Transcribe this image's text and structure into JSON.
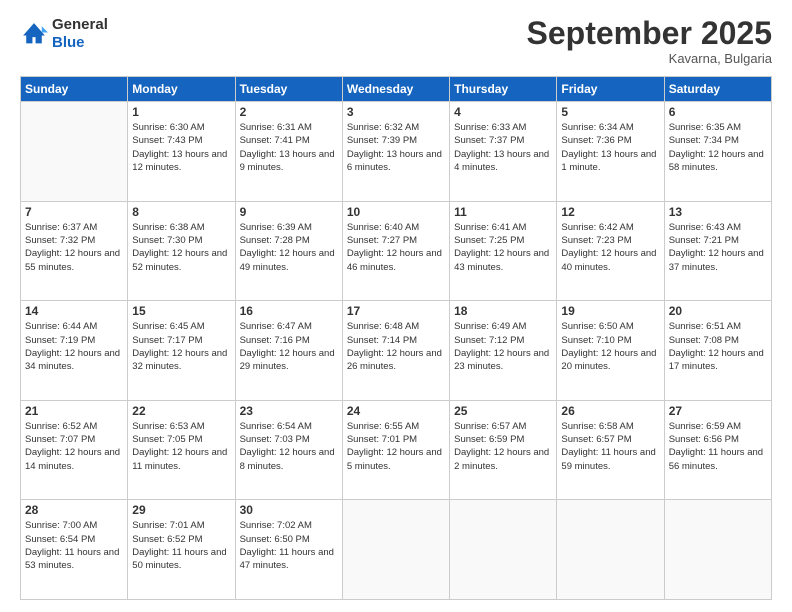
{
  "logo": {
    "line1": "General",
    "line2": "Blue"
  },
  "title": "September 2025",
  "subtitle": "Kavarna, Bulgaria",
  "days_header": [
    "Sunday",
    "Monday",
    "Tuesday",
    "Wednesday",
    "Thursday",
    "Friday",
    "Saturday"
  ],
  "weeks": [
    [
      {
        "day": "",
        "sunrise": "",
        "sunset": "",
        "daylight": ""
      },
      {
        "day": "1",
        "sunrise": "Sunrise: 6:30 AM",
        "sunset": "Sunset: 7:43 PM",
        "daylight": "Daylight: 13 hours and 12 minutes."
      },
      {
        "day": "2",
        "sunrise": "Sunrise: 6:31 AM",
        "sunset": "Sunset: 7:41 PM",
        "daylight": "Daylight: 13 hours and 9 minutes."
      },
      {
        "day": "3",
        "sunrise": "Sunrise: 6:32 AM",
        "sunset": "Sunset: 7:39 PM",
        "daylight": "Daylight: 13 hours and 6 minutes."
      },
      {
        "day": "4",
        "sunrise": "Sunrise: 6:33 AM",
        "sunset": "Sunset: 7:37 PM",
        "daylight": "Daylight: 13 hours and 4 minutes."
      },
      {
        "day": "5",
        "sunrise": "Sunrise: 6:34 AM",
        "sunset": "Sunset: 7:36 PM",
        "daylight": "Daylight: 13 hours and 1 minute."
      },
      {
        "day": "6",
        "sunrise": "Sunrise: 6:35 AM",
        "sunset": "Sunset: 7:34 PM",
        "daylight": "Daylight: 12 hours and 58 minutes."
      }
    ],
    [
      {
        "day": "7",
        "sunrise": "Sunrise: 6:37 AM",
        "sunset": "Sunset: 7:32 PM",
        "daylight": "Daylight: 12 hours and 55 minutes."
      },
      {
        "day": "8",
        "sunrise": "Sunrise: 6:38 AM",
        "sunset": "Sunset: 7:30 PM",
        "daylight": "Daylight: 12 hours and 52 minutes."
      },
      {
        "day": "9",
        "sunrise": "Sunrise: 6:39 AM",
        "sunset": "Sunset: 7:28 PM",
        "daylight": "Daylight: 12 hours and 49 minutes."
      },
      {
        "day": "10",
        "sunrise": "Sunrise: 6:40 AM",
        "sunset": "Sunset: 7:27 PM",
        "daylight": "Daylight: 12 hours and 46 minutes."
      },
      {
        "day": "11",
        "sunrise": "Sunrise: 6:41 AM",
        "sunset": "Sunset: 7:25 PM",
        "daylight": "Daylight: 12 hours and 43 minutes."
      },
      {
        "day": "12",
        "sunrise": "Sunrise: 6:42 AM",
        "sunset": "Sunset: 7:23 PM",
        "daylight": "Daylight: 12 hours and 40 minutes."
      },
      {
        "day": "13",
        "sunrise": "Sunrise: 6:43 AM",
        "sunset": "Sunset: 7:21 PM",
        "daylight": "Daylight: 12 hours and 37 minutes."
      }
    ],
    [
      {
        "day": "14",
        "sunrise": "Sunrise: 6:44 AM",
        "sunset": "Sunset: 7:19 PM",
        "daylight": "Daylight: 12 hours and 34 minutes."
      },
      {
        "day": "15",
        "sunrise": "Sunrise: 6:45 AM",
        "sunset": "Sunset: 7:17 PM",
        "daylight": "Daylight: 12 hours and 32 minutes."
      },
      {
        "day": "16",
        "sunrise": "Sunrise: 6:47 AM",
        "sunset": "Sunset: 7:16 PM",
        "daylight": "Daylight: 12 hours and 29 minutes."
      },
      {
        "day": "17",
        "sunrise": "Sunrise: 6:48 AM",
        "sunset": "Sunset: 7:14 PM",
        "daylight": "Daylight: 12 hours and 26 minutes."
      },
      {
        "day": "18",
        "sunrise": "Sunrise: 6:49 AM",
        "sunset": "Sunset: 7:12 PM",
        "daylight": "Daylight: 12 hours and 23 minutes."
      },
      {
        "day": "19",
        "sunrise": "Sunrise: 6:50 AM",
        "sunset": "Sunset: 7:10 PM",
        "daylight": "Daylight: 12 hours and 20 minutes."
      },
      {
        "day": "20",
        "sunrise": "Sunrise: 6:51 AM",
        "sunset": "Sunset: 7:08 PM",
        "daylight": "Daylight: 12 hours and 17 minutes."
      }
    ],
    [
      {
        "day": "21",
        "sunrise": "Sunrise: 6:52 AM",
        "sunset": "Sunset: 7:07 PM",
        "daylight": "Daylight: 12 hours and 14 minutes."
      },
      {
        "day": "22",
        "sunrise": "Sunrise: 6:53 AM",
        "sunset": "Sunset: 7:05 PM",
        "daylight": "Daylight: 12 hours and 11 minutes."
      },
      {
        "day": "23",
        "sunrise": "Sunrise: 6:54 AM",
        "sunset": "Sunset: 7:03 PM",
        "daylight": "Daylight: 12 hours and 8 minutes."
      },
      {
        "day": "24",
        "sunrise": "Sunrise: 6:55 AM",
        "sunset": "Sunset: 7:01 PM",
        "daylight": "Daylight: 12 hours and 5 minutes."
      },
      {
        "day": "25",
        "sunrise": "Sunrise: 6:57 AM",
        "sunset": "Sunset: 6:59 PM",
        "daylight": "Daylight: 12 hours and 2 minutes."
      },
      {
        "day": "26",
        "sunrise": "Sunrise: 6:58 AM",
        "sunset": "Sunset: 6:57 PM",
        "daylight": "Daylight: 11 hours and 59 minutes."
      },
      {
        "day": "27",
        "sunrise": "Sunrise: 6:59 AM",
        "sunset": "Sunset: 6:56 PM",
        "daylight": "Daylight: 11 hours and 56 minutes."
      }
    ],
    [
      {
        "day": "28",
        "sunrise": "Sunrise: 7:00 AM",
        "sunset": "Sunset: 6:54 PM",
        "daylight": "Daylight: 11 hours and 53 minutes."
      },
      {
        "day": "29",
        "sunrise": "Sunrise: 7:01 AM",
        "sunset": "Sunset: 6:52 PM",
        "daylight": "Daylight: 11 hours and 50 minutes."
      },
      {
        "day": "30",
        "sunrise": "Sunrise: 7:02 AM",
        "sunset": "Sunset: 6:50 PM",
        "daylight": "Daylight: 11 hours and 47 minutes."
      },
      {
        "day": "",
        "sunrise": "",
        "sunset": "",
        "daylight": ""
      },
      {
        "day": "",
        "sunrise": "",
        "sunset": "",
        "daylight": ""
      },
      {
        "day": "",
        "sunrise": "",
        "sunset": "",
        "daylight": ""
      },
      {
        "day": "",
        "sunrise": "",
        "sunset": "",
        "daylight": ""
      }
    ]
  ]
}
